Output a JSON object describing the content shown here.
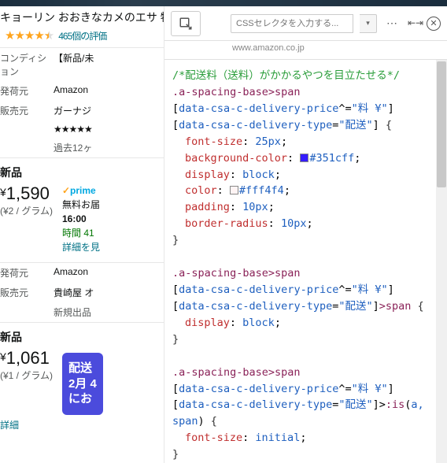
{
  "product": {
    "title": "キョーリン おおきなカメのエサ 特",
    "review_count": "465個の評価",
    "row1_label": "コンディション",
    "row1_value": "【新品/未",
    "row2_label": "発荷元",
    "row2_value": "Amazon",
    "row3_label": "販売元",
    "row3_value": "ガーナジ",
    "seller_rating": "★★★★★",
    "past12": "過去12ヶ"
  },
  "offer1": {
    "condition": "新品",
    "currency": "¥",
    "price": "1,590",
    "unit": "(¥2 / グラム)",
    "prime": "prime",
    "ship_free": "無料お届",
    "ship_time": "16:00",
    "countdown": "時間 41",
    "detail": "詳細を見"
  },
  "ship2": {
    "row_ship_label": "発荷元",
    "row_ship_value": "Amazon",
    "row_seller_label": "販売元",
    "row_seller_value": "貴崎屋 オ",
    "new_listing": "新規出品"
  },
  "offer2": {
    "condition": "新品",
    "currency": "¥",
    "price": "1,061",
    "unit": "(¥1 / グラム)",
    "promo_l1": "配送",
    "promo_l2": "2月 4",
    "promo_l3": "にお",
    "detail": "詳細"
  },
  "dev": {
    "selector_placeholder": "CSSセレクタを入力する...",
    "url": "www.amazon.co.jp"
  },
  "css": {
    "comment": "/*配送料（送料）がかかるやつを目立たせる*/",
    "sel_spacing": ".a-spacing-base",
    "sel_span": ">span",
    "attr_price_name": "data-csa-c-delivery-price",
    "attr_price_val": "\"料 ¥\"",
    "attr_type_name": "data-csa-c-delivery-type",
    "attr_type_val": "\"配送\"",
    "p_font_size": "font-size",
    "v_25px": "25px",
    "p_bg": "background-color",
    "v_bg": "#351cff",
    "p_display": "display",
    "v_block": "block",
    "p_color": "color",
    "v_color": "#fff4f4",
    "p_padding": "padding",
    "v_10px": "10px",
    "p_radius": "border-radius",
    "rule2_tail": ">span",
    "rule3_is": ":is",
    "rule3_args": "a,\nspan",
    "v_initial": "initial"
  }
}
